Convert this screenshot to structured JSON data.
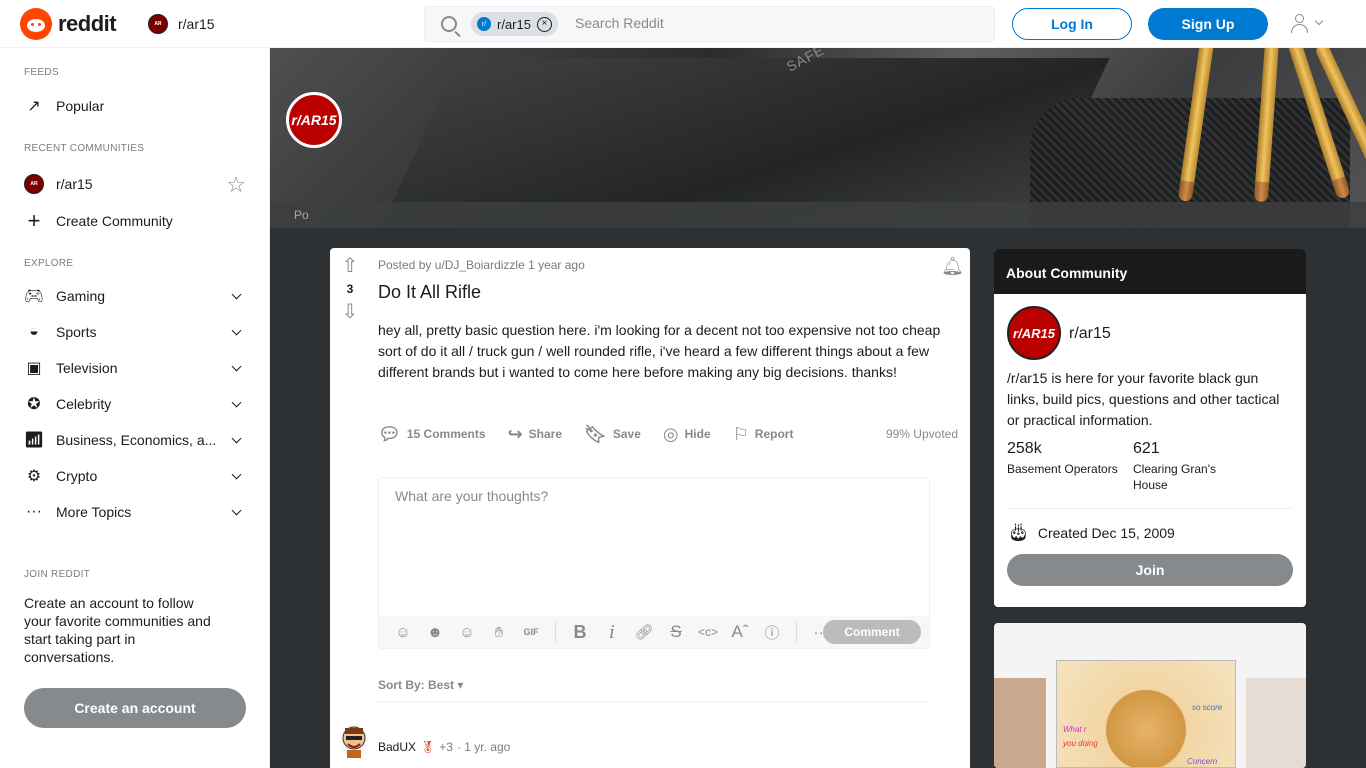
{
  "header": {
    "logo_text": "reddit",
    "community": "r/ar15",
    "search_chip": "r/ar15",
    "search_chip_prefix": "r/",
    "search_placeholder": "Search Reddit",
    "login_label": "Log In",
    "signup_label": "Sign Up"
  },
  "sidebar": {
    "feeds_label": "FEEDS",
    "popular": "Popular",
    "recent_label": "RECENT COMMUNITIES",
    "recent_item": "r/ar15",
    "create_community": "Create Community",
    "explore_label": "EXPLORE",
    "explore_items": [
      "Gaming",
      "Sports",
      "Television",
      "Celebrity",
      "Business, Economics, a...",
      "Crypto",
      "More Topics"
    ],
    "join_label": "JOIN REDDIT",
    "join_text": "Create an account to follow your favorite communities and start taking part in conversations.",
    "create_account": "Create an account"
  },
  "banner": {
    "avatar_text": "r/AR15",
    "tab_text": "Po",
    "engraving": "SAFE"
  },
  "post": {
    "score": "3",
    "meta": "Posted by u/DJ_Boiardizzle 1 year ago",
    "title": "Do It All Rifle",
    "body": "hey all, pretty basic question here. i'm looking for a decent not too expensive not too cheap sort of do it all / truck gun / well rounded rifle, i've heard a few different things about a few different brands but i wanted to come here before making any big decisions. thanks!",
    "actions": {
      "comments": "15 Comments",
      "share": "Share",
      "save": "Save",
      "hide": "Hide",
      "report": "Report"
    },
    "upvoted": "99% Upvoted",
    "editor_placeholder": "What are your thoughts?",
    "comment_button": "Comment",
    "sort_label": "Sort By: Best",
    "first_comment": {
      "user": "BadUX",
      "score": "+3",
      "time": "· 1 yr. ago"
    }
  },
  "about": {
    "heading": "About Community",
    "name": "r/ar15",
    "avatar_text": "r/AR15",
    "description": "/r/ar15 is here for your favorite black gun links, build pics, questions and other tactical or practical information.",
    "members": "258k",
    "members_label": "Basement Operators",
    "online": "621",
    "online_label": "Clearing Gran's House",
    "created": "Created Dec 15, 2009",
    "join_label": "Join"
  },
  "ad": {
    "text1": "so score",
    "text2": "What r",
    "text3": "you doing",
    "text4": "Concern"
  },
  "colors": {
    "brand": "#ff4500",
    "accent": "#0079d3",
    "sidebar_bg": "#ffffff",
    "page_bg": "#2e3133"
  }
}
